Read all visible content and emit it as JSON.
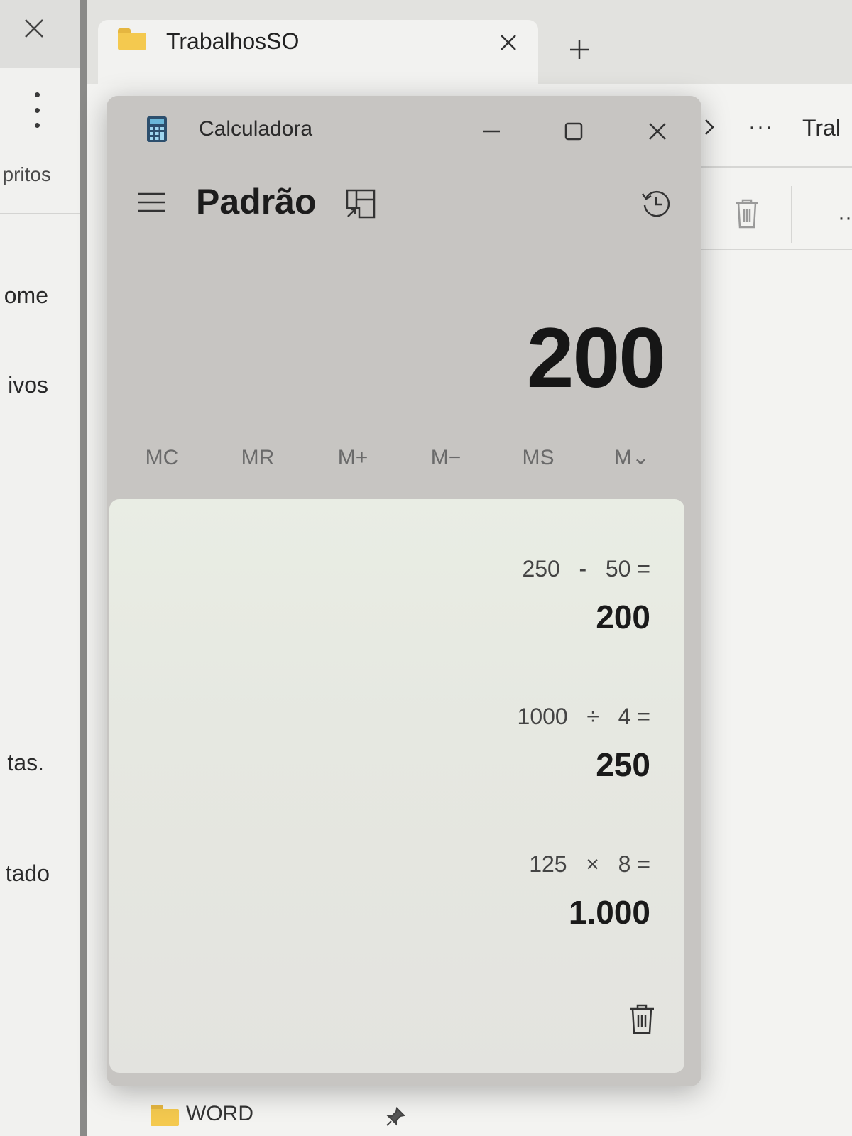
{
  "left_window": {
    "items": [
      "pritos",
      "ome",
      "ivos",
      "tas.",
      "tado"
    ]
  },
  "explorer": {
    "tab_title": "TrabalhosSO",
    "more_label": "···",
    "breadcrumb_fragment": "Tral",
    "quick_access_item": "WORD"
  },
  "calculator": {
    "window_title": "Calculadora",
    "mode": "Padrão",
    "display": "200",
    "memory_buttons": [
      "MC",
      "MR",
      "M+",
      "M−",
      "MS",
      "M⌄"
    ],
    "history": [
      {
        "expression": "250   -   50 =",
        "result": "200"
      },
      {
        "expression": "1000   ÷   4 =",
        "result": "250"
      },
      {
        "expression": "125   ×   8 =",
        "result": "1.000"
      }
    ]
  },
  "colors": {
    "folder": "#f4c94f",
    "calc_chrome": "#c7c5c2",
    "history_bg": "#e6e8e1"
  }
}
